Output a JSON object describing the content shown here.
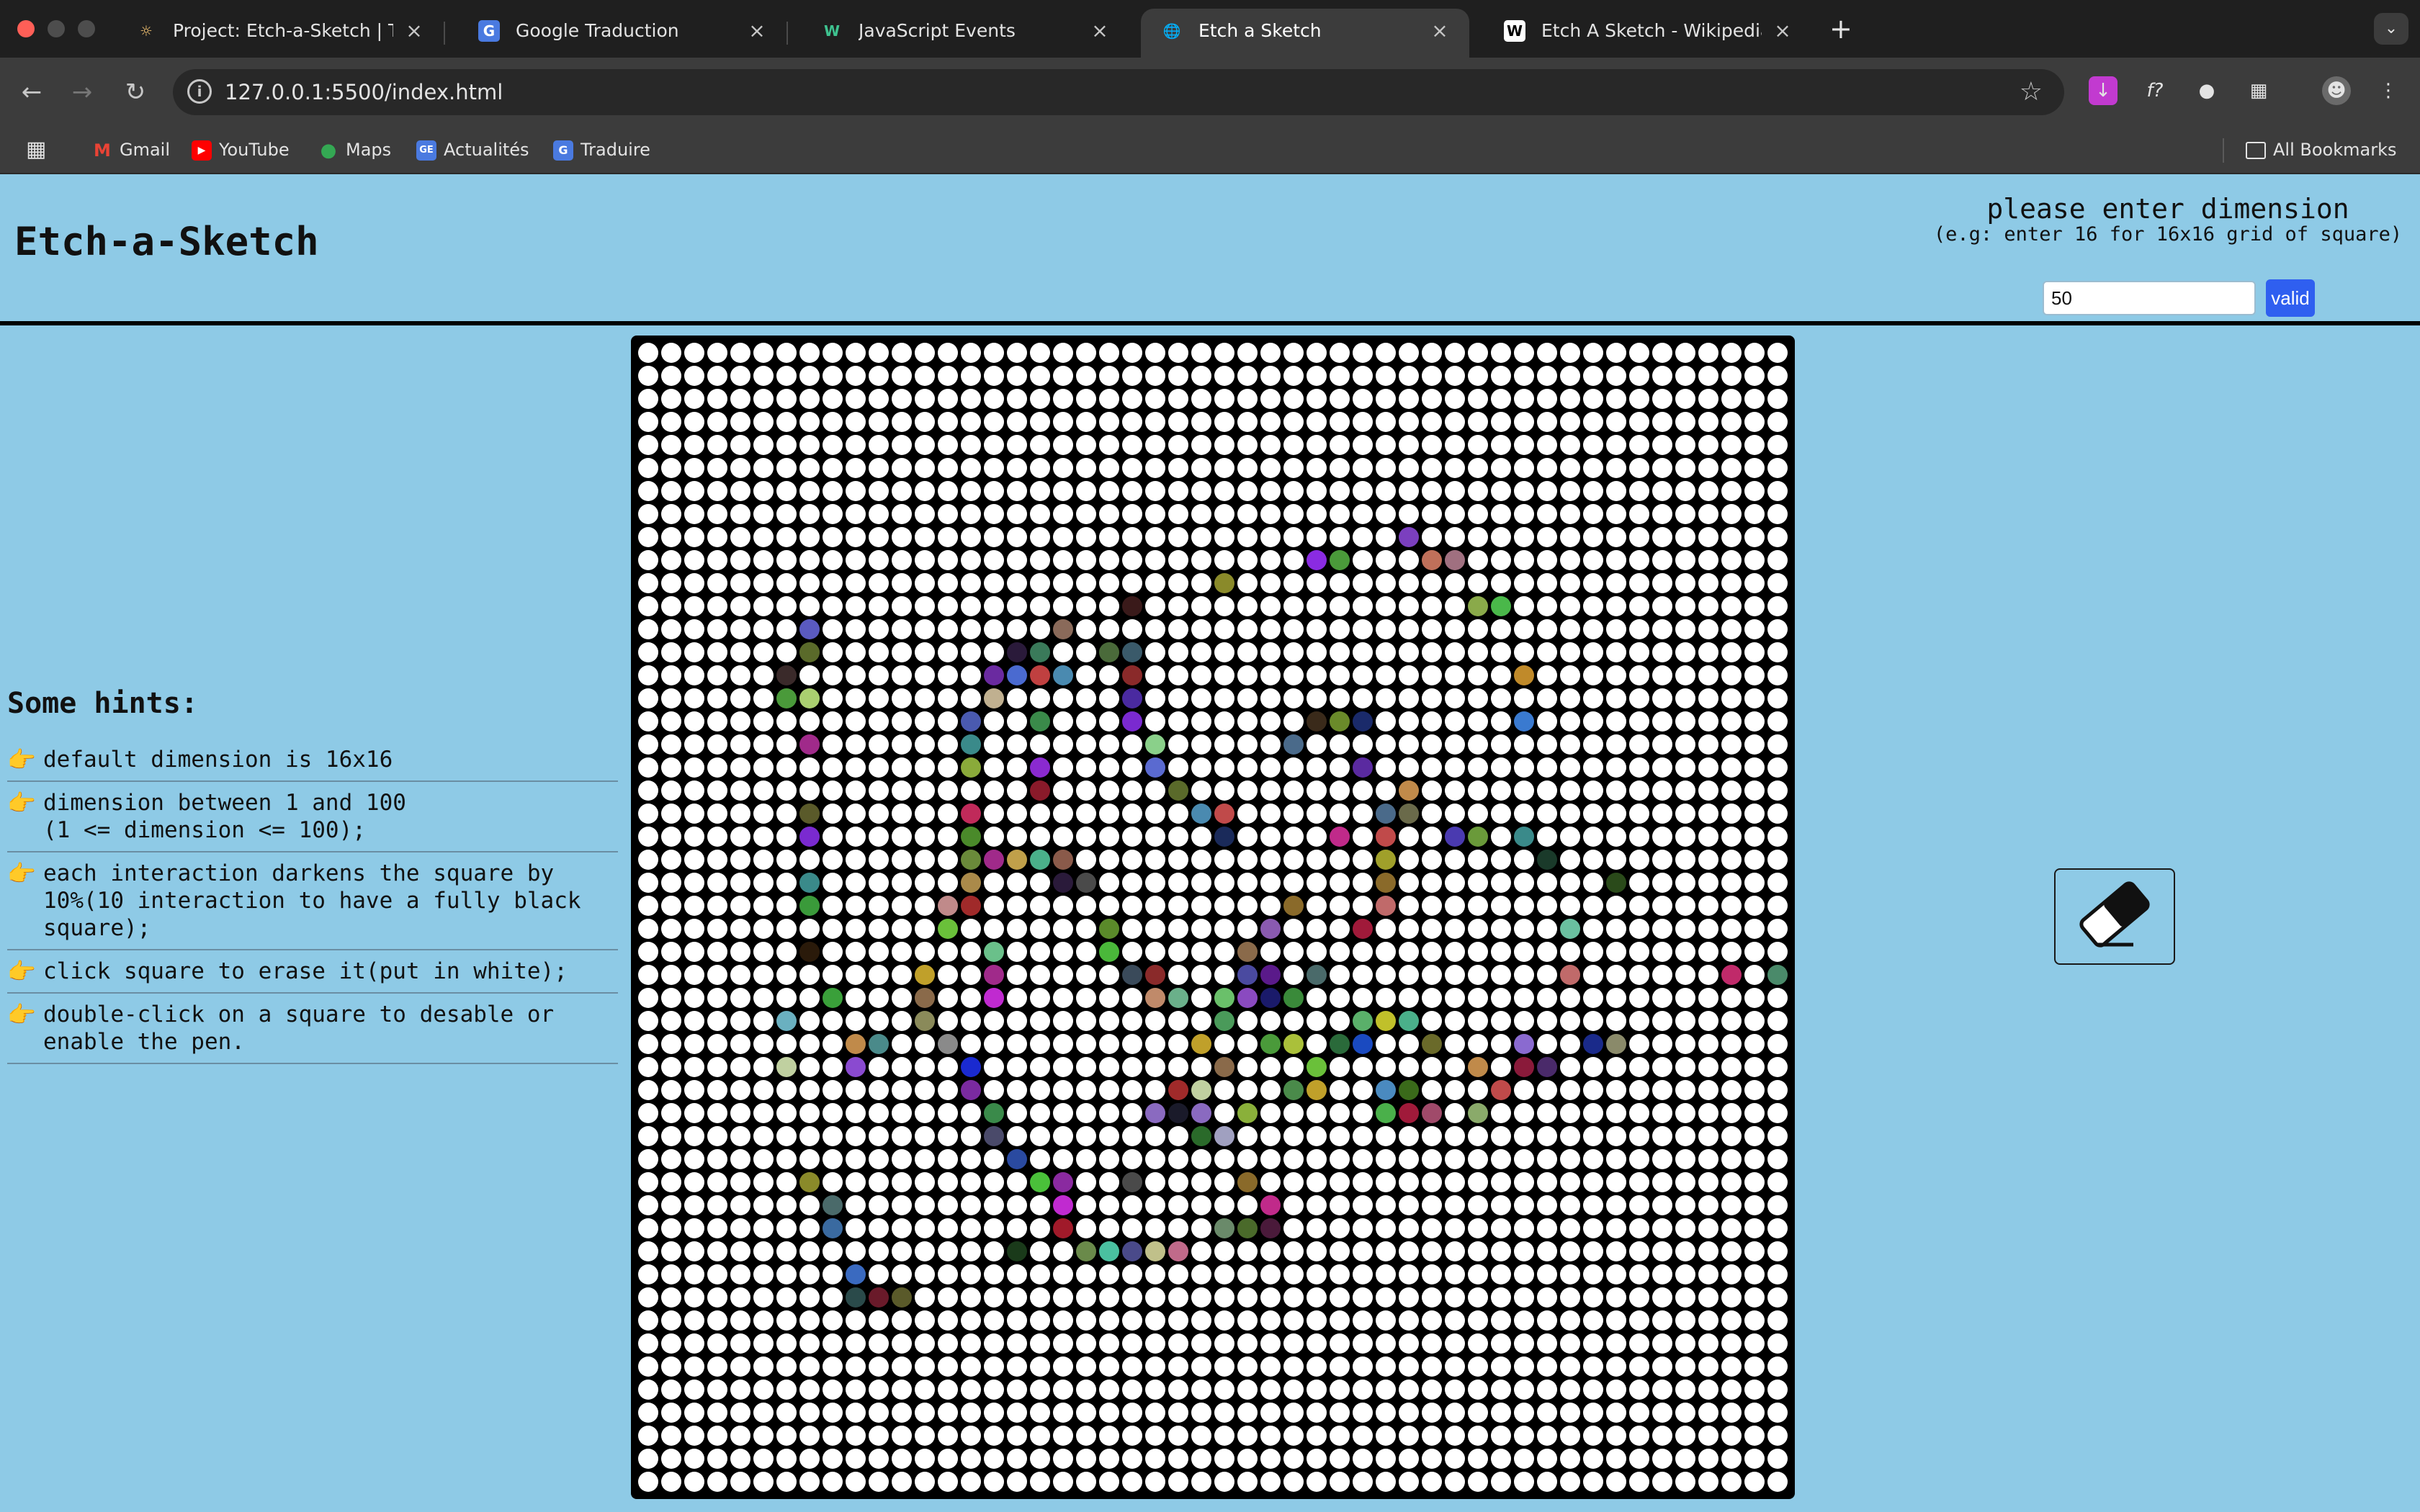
{
  "browser": {
    "tabs": [
      {
        "title": "Project: Etch-a-Sketch | The O",
        "active": false,
        "favicon": "odin-icon"
      },
      {
        "title": "Google Traduction",
        "active": false,
        "favicon": "google-translate-icon"
      },
      {
        "title": "JavaScript Events",
        "active": false,
        "favicon": "w-icon"
      },
      {
        "title": "Etch a Sketch",
        "active": true,
        "favicon": "globe-icon"
      },
      {
        "title": "Etch A Sketch - Wikipedia",
        "active": false,
        "favicon": "wikipedia-icon"
      }
    ],
    "url": "127.0.0.1:5500/index.html",
    "bookmarks": [
      "Gmail",
      "YouTube",
      "Maps",
      "Actualités",
      "Traduire"
    ],
    "all_bookmarks": "All Bookmarks"
  },
  "app": {
    "title": "Etch-a-Sketch",
    "prompt": "please enter dimension",
    "example": "(e.g: enter 16 for 16x16 grid of square)",
    "dimension_value": "50",
    "valid_label": "valid",
    "hints_title": "Some hints:",
    "hints": [
      "default dimension is 16x16",
      "dimension between 1 and 100\n(1 <= dimension <= 100);",
      "each interaction darkens the square by\n10%(10 interaction to have a fully black\nsquare);",
      "click square to erase it(put in white);",
      "double-click on a square to desable or\nenable the pen."
    ],
    "hint_icon": "pointing-hand-icon",
    "eraser_icon": "eraser-icon"
  },
  "grid": {
    "size": 50,
    "colored_cells": [
      [
        8,
        33,
        "#7b3fbf"
      ],
      [
        9,
        29,
        "#8a2be2"
      ],
      [
        9,
        30,
        "#4a9a3a"
      ],
      [
        9,
        34,
        "#c0705a"
      ],
      [
        9,
        35,
        "#a07080"
      ],
      [
        10,
        25,
        "#8a8a2a"
      ],
      [
        11,
        21,
        "#3a1a1a"
      ],
      [
        11,
        36,
        "#8aaa4a"
      ],
      [
        11,
        37,
        "#4ab84a"
      ],
      [
        12,
        7,
        "#5a5ac0"
      ],
      [
        12,
        18,
        "#8a6a5a"
      ],
      [
        13,
        7,
        "#5a6a2a"
      ],
      [
        13,
        16,
        "#2a1a3a"
      ],
      [
        13,
        17,
        "#3a7a5a"
      ],
      [
        13,
        20,
        "#4a6a3a"
      ],
      [
        13,
        21,
        "#3a5a6a"
      ],
      [
        14,
        6,
        "#3a2a2a"
      ],
      [
        14,
        15,
        "#6a2aa0"
      ],
      [
        14,
        16,
        "#4a6ad0"
      ],
      [
        14,
        17,
        "#c04040"
      ],
      [
        14,
        18,
        "#4a8ab0"
      ],
      [
        14,
        21,
        "#8a2a2a"
      ],
      [
        14,
        38,
        "#c08a2a"
      ],
      [
        15,
        6,
        "#4a9a3a"
      ],
      [
        15,
        7,
        "#aad070"
      ],
      [
        15,
        15,
        "#c0b090"
      ],
      [
        15,
        21,
        "#4a2aa0"
      ],
      [
        16,
        14,
        "#4a5ab0"
      ],
      [
        16,
        17,
        "#3a8a4a"
      ],
      [
        16,
        21,
        "#7a2ad0"
      ],
      [
        16,
        29,
        "#3a2a1a"
      ],
      [
        16,
        30,
        "#6a8a2a"
      ],
      [
        16,
        31,
        "#1a2a6a"
      ],
      [
        16,
        38,
        "#3a7ad0"
      ],
      [
        17,
        7,
        "#a02a8a"
      ],
      [
        17,
        14,
        "#3a8a8a"
      ],
      [
        17,
        22,
        "#8ad08a"
      ],
      [
        17,
        28,
        "#4a6a8a"
      ],
      [
        18,
        14,
        "#8aaa3a"
      ],
      [
        18,
        17,
        "#8a2ad0"
      ],
      [
        18,
        22,
        "#5a6ad0"
      ],
      [
        18,
        31,
        "#5a2aa0"
      ],
      [
        19,
        17,
        "#8a1a2a"
      ],
      [
        19,
        23,
        "#5a6a2a"
      ],
      [
        19,
        33,
        "#c08a4a"
      ],
      [
        20,
        7,
        "#5a5a2a"
      ],
      [
        20,
        14,
        "#c02a5a"
      ],
      [
        20,
        24,
        "#4a8ab0"
      ],
      [
        20,
        25,
        "#c04a4a"
      ],
      [
        20,
        32,
        "#4a6a8a"
      ],
      [
        20,
        33,
        "#6a6a4a"
      ],
      [
        21,
        7,
        "#7a2ad0"
      ],
      [
        21,
        14,
        "#4a8a2a"
      ],
      [
        21,
        25,
        "#1a2a5a"
      ],
      [
        21,
        30,
        "#c02a8a"
      ],
      [
        21,
        32,
        "#c04a4a"
      ],
      [
        21,
        35,
        "#4a3ab0"
      ],
      [
        21,
        36,
        "#6a9a3a"
      ],
      [
        21,
        38,
        "#3a8a8a"
      ],
      [
        22,
        14,
        "#6a8a3a"
      ],
      [
        22,
        15,
        "#a02a8a"
      ],
      [
        22,
        16,
        "#c0a04a"
      ],
      [
        22,
        17,
        "#4ab08a"
      ],
      [
        22,
        18,
        "#8a5a4a"
      ],
      [
        22,
        32,
        "#a0a02a"
      ],
      [
        22,
        39,
        "#1a3a2a"
      ],
      [
        23,
        7,
        "#3a8a8a"
      ],
      [
        23,
        14,
        "#aa8a4a"
      ],
      [
        23,
        18,
        "#2a1a3a"
      ],
      [
        23,
        19,
        "#4a4a4a"
      ],
      [
        23,
        32,
        "#8a6a2a"
      ],
      [
        23,
        42,
        "#2a4a1a"
      ],
      [
        24,
        7,
        "#3a9a3a"
      ],
      [
        24,
        13,
        "#c08a8a"
      ],
      [
        24,
        14,
        "#a02a2a"
      ],
      [
        24,
        28,
        "#8a6a2a"
      ],
      [
        24,
        32,
        "#c06a6a"
      ],
      [
        25,
        13,
        "#6ac03a"
      ],
      [
        25,
        20,
        "#5a8a2a"
      ],
      [
        25,
        27,
        "#8a5ab0"
      ],
      [
        25,
        31,
        "#a01a3a"
      ],
      [
        25,
        40,
        "#6ac0a0"
      ],
      [
        26,
        7,
        "#2a1a0a"
      ],
      [
        26,
        15,
        "#6ac08a"
      ],
      [
        26,
        20,
        "#4ab83a"
      ],
      [
        26,
        26,
        "#8a6a4a"
      ],
      [
        27,
        12,
        "#c0a02a"
      ],
      [
        27,
        15,
        "#a02a8a"
      ],
      [
        27,
        21,
        "#3a4a5a"
      ],
      [
        27,
        22,
        "#8a2a2a"
      ],
      [
        27,
        26,
        "#4a4aa0"
      ],
      [
        27,
        27,
        "#5a1a8a"
      ],
      [
        27,
        29,
        "#4a6a6a"
      ],
      [
        27,
        40,
        "#c06a6a"
      ],
      [
        27,
        47,
        "#c02a6a"
      ],
      [
        27,
        49,
        "#4a8a6a"
      ],
      [
        28,
        8,
        "#3aa03a"
      ],
      [
        28,
        12,
        "#8a6a4a"
      ],
      [
        28,
        15,
        "#c02ad0"
      ],
      [
        28,
        22,
        "#c08a6a"
      ],
      [
        28,
        23,
        "#6ab08a"
      ],
      [
        28,
        25,
        "#6ac06a"
      ],
      [
        28,
        26,
        "#8a4ac0"
      ],
      [
        28,
        27,
        "#1a1a6a"
      ],
      [
        28,
        28,
        "#3a8a3a"
      ],
      [
        29,
        6,
        "#6ab0c0"
      ],
      [
        29,
        12,
        "#8a8a5a"
      ],
      [
        29,
        25,
        "#4a9a5a"
      ],
      [
        29,
        31,
        "#5ab06a"
      ],
      [
        29,
        32,
        "#c0c02a"
      ],
      [
        29,
        33,
        "#4ab08a"
      ],
      [
        30,
        9,
        "#c08a4a"
      ],
      [
        30,
        10,
        "#4a8a8a"
      ],
      [
        30,
        13,
        "#8a8a8a"
      ],
      [
        30,
        24,
        "#c0a02a"
      ],
      [
        30,
        27,
        "#4a9a3a"
      ],
      [
        30,
        28,
        "#aac03a"
      ],
      [
        30,
        30,
        "#2a6a3a"
      ],
      [
        30,
        31,
        "#1a4ac0"
      ],
      [
        30,
        34,
        "#6a6a2a"
      ],
      [
        30,
        38,
        "#8a6ad0"
      ],
      [
        30,
        41,
        "#1a2a8a"
      ],
      [
        30,
        42,
        "#8a8a6a"
      ],
      [
        31,
        6,
        "#c0d0a0"
      ],
      [
        31,
        9,
        "#8a4ad0"
      ],
      [
        31,
        14,
        "#1a2ad0"
      ],
      [
        31,
        25,
        "#8a6a4a"
      ],
      [
        31,
        29,
        "#6ac03a"
      ],
      [
        31,
        36,
        "#c08a4a"
      ],
      [
        31,
        38,
        "#8a1a3a"
      ],
      [
        31,
        39,
        "#4a2a6a"
      ],
      [
        32,
        14,
        "#7a2aa0"
      ],
      [
        32,
        23,
        "#a02a2a"
      ],
      [
        32,
        24,
        "#c0d0a0"
      ],
      [
        32,
        28,
        "#4a8a4a"
      ],
      [
        32,
        29,
        "#c0a02a"
      ],
      [
        32,
        32,
        "#4a8ac0"
      ],
      [
        32,
        33,
        "#3a6a1a"
      ],
      [
        32,
        37,
        "#c04a4a"
      ],
      [
        33,
        15,
        "#3a8a4a"
      ],
      [
        33,
        22,
        "#8a6ac0"
      ],
      [
        33,
        23,
        "#1a1a2a"
      ],
      [
        33,
        24,
        "#8a6ac0"
      ],
      [
        33,
        26,
        "#8ab03a"
      ],
      [
        33,
        32,
        "#4ab04a"
      ],
      [
        33,
        33,
        "#a01a3a"
      ],
      [
        33,
        34,
        "#a04a6a"
      ],
      [
        33,
        36,
        "#8aaa6a"
      ],
      [
        34,
        15,
        "#4a4a6a"
      ],
      [
        34,
        24,
        "#2a6a2a"
      ],
      [
        34,
        25,
        "#a0a0c0"
      ],
      [
        35,
        16,
        "#2a4aa0"
      ],
      [
        36,
        7,
        "#8a8a2a"
      ],
      [
        36,
        17,
        "#4ac03a"
      ],
      [
        36,
        18,
        "#8a2aa0"
      ],
      [
        36,
        21,
        "#4a4a4a"
      ],
      [
        36,
        26,
        "#8a6a2a"
      ],
      [
        37,
        8,
        "#4a6a6a"
      ],
      [
        37,
        18,
        "#c02ad0"
      ],
      [
        37,
        27,
        "#c02a8a"
      ],
      [
        38,
        8,
        "#3a6aa0"
      ],
      [
        38,
        18,
        "#a01a2a"
      ],
      [
        38,
        25,
        "#6a8a6a"
      ],
      [
        38,
        26,
        "#4a6a2a"
      ],
      [
        38,
        27,
        "#4a1a3a"
      ],
      [
        39,
        16,
        "#1a3a1a"
      ],
      [
        39,
        19,
        "#6a8a4a"
      ],
      [
        39,
        20,
        "#4ac0a0"
      ],
      [
        39,
        21,
        "#4a4a8a"
      ],
      [
        39,
        22,
        "#c0c08a"
      ],
      [
        39,
        23,
        "#c06a8a"
      ],
      [
        40,
        9,
        "#3a6ac0"
      ],
      [
        41,
        9,
        "#2a4a4a"
      ],
      [
        41,
        10,
        "#6a1a2a"
      ],
      [
        41,
        11,
        "#5a5a2a"
      ]
    ]
  }
}
